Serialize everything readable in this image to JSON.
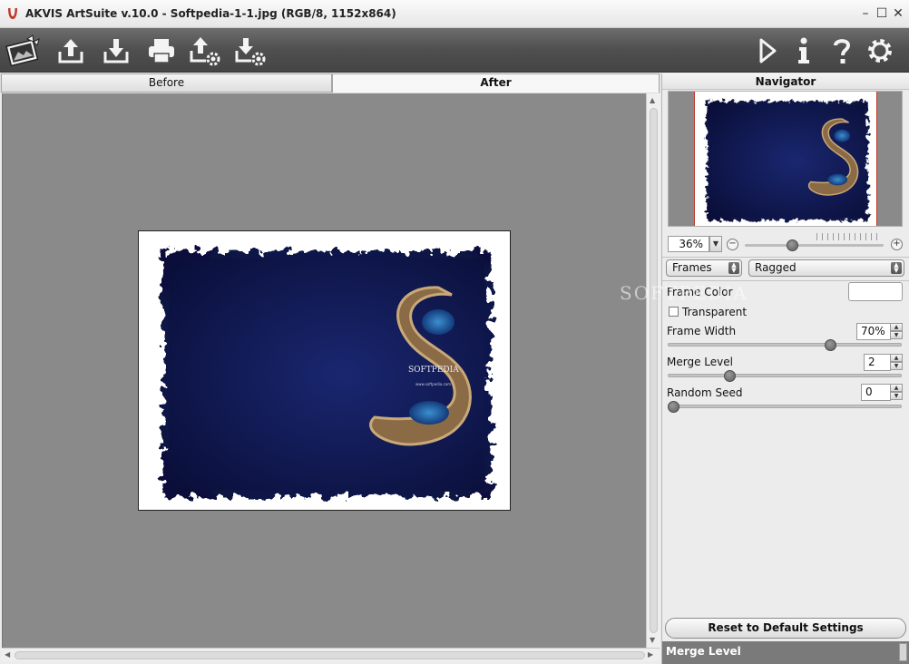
{
  "window": {
    "title": "AKVIS ArtSuite v.10.0 - Softpedia-1-1.jpg (RGB/8, 1152x864)",
    "controls": [
      "minimize",
      "maximize",
      "close"
    ]
  },
  "toolbar": {
    "left_icons": [
      "photo-gift-icon",
      "open-upload-icon",
      "save-download-icon",
      "print-icon",
      "import-settings-icon",
      "export-settings-icon"
    ],
    "right_icons": [
      "run-icon",
      "info-icon",
      "help-icon",
      "settings-gear-icon"
    ]
  },
  "tabs": {
    "before": "Before",
    "after": "After",
    "active": "After"
  },
  "image": {
    "watermark_text": "SOFTPEDIA",
    "sub_text": "www.softpedia.com",
    "colors": {
      "background": "#0d1448",
      "frame": "#ffffff"
    }
  },
  "navigator": {
    "title": "Navigator",
    "zoom": "36%"
  },
  "effect": {
    "category": "Frames",
    "style": "Ragged"
  },
  "settings": {
    "frame_color_label": "Frame Color",
    "frame_color": "#ffffff",
    "transparent_label": "Transparent",
    "transparent_checked": false,
    "frame_width_label": "Frame Width",
    "frame_width": "70%",
    "frame_width_fraction": 0.7,
    "merge_level_label": "Merge Level",
    "merge_level": "2",
    "merge_level_fraction": 0.24,
    "random_seed_label": "Random Seed",
    "random_seed": "0",
    "random_seed_fraction": 0.0
  },
  "reset_button": "Reset to Default Settings",
  "hint_title": "Merge Level",
  "overlay_watermark": "SOFTPEDIA"
}
